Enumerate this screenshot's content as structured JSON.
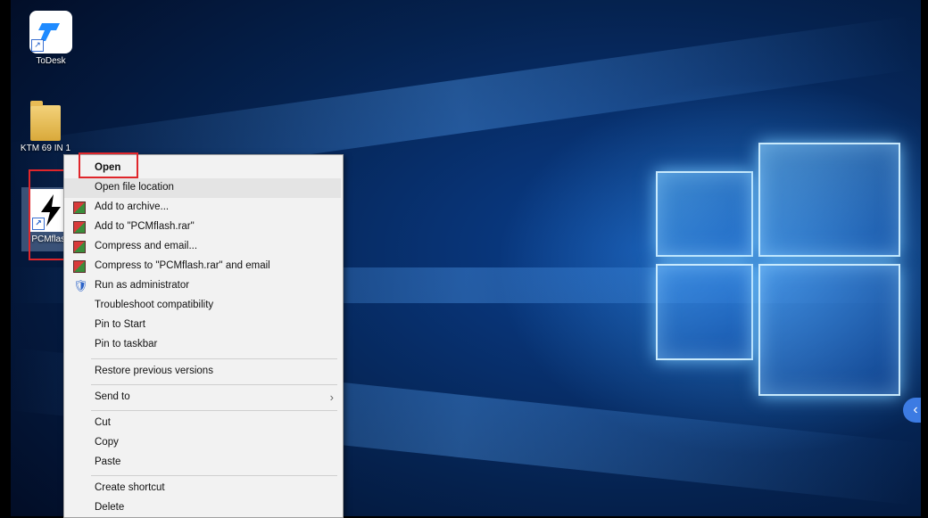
{
  "desktop": {
    "icons": [
      {
        "label": "ToDesk",
        "icon": "todesk-icon"
      },
      {
        "label": "KTM 69 IN 1",
        "icon": "folder-icon"
      },
      {
        "label": "PCMflash",
        "icon": "pcmflash-icon"
      }
    ]
  },
  "context_menu": {
    "items": [
      {
        "label": "Open",
        "icon": ""
      },
      {
        "label": "Open file location",
        "icon": ""
      },
      {
        "label": "Add to archive...",
        "icon": "winrar-icon"
      },
      {
        "label": "Add to \"PCMflash.rar\"",
        "icon": "winrar-icon"
      },
      {
        "label": "Compress and email...",
        "icon": "winrar-icon"
      },
      {
        "label": "Compress to \"PCMflash.rar\" and email",
        "icon": "winrar-icon"
      },
      {
        "label": "Run as administrator",
        "icon": "uac-shield-icon"
      },
      {
        "label": "Troubleshoot compatibility",
        "icon": ""
      },
      {
        "label": "Pin to Start",
        "icon": ""
      },
      {
        "label": "Pin to taskbar",
        "icon": ""
      },
      {
        "label": "Restore previous versions",
        "icon": ""
      },
      {
        "label": "Send to",
        "icon": "chevron-right-icon"
      },
      {
        "label": "Cut",
        "icon": ""
      },
      {
        "label": "Copy",
        "icon": ""
      },
      {
        "label": "Paste",
        "icon": ""
      },
      {
        "label": "Create shortcut",
        "icon": ""
      },
      {
        "label": "Delete",
        "icon": ""
      }
    ]
  },
  "colors": {
    "highlight_box": "#e0262b",
    "menu_bg": "#f2f2f2",
    "side_toggle": "#3c7be3"
  },
  "side_toggle": {
    "glyph": "‹"
  }
}
